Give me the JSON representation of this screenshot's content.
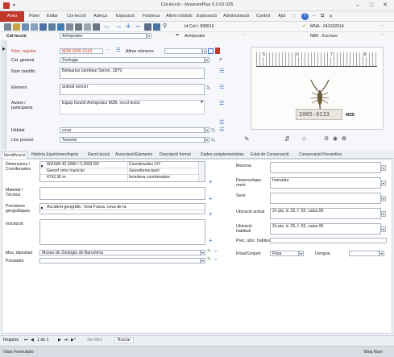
{
  "window": {
    "title": "Col·lecció - MuseumPlus 5.0.02 025",
    "minimize": "–",
    "maximize": "□",
    "close": "✕"
  },
  "menu": [
    "Arxiu",
    "Fitxer",
    "Editar",
    "Col·lecció",
    "Adreça",
    "Exposició",
    "Fototeca",
    "Altres mòduls",
    "Exploració",
    "Administració",
    "Control",
    "Ajut"
  ],
  "toolbar": {
    "help_icon": "?"
  },
  "record": {
    "module_label": "Col·lecció",
    "module_value": "Artròpodes",
    "id_label": "Id Col·l: 899516",
    "id_value": "Artròpodes",
    "user": "MNA - 24/10/2014",
    "user2": "NBfr - Escriure"
  },
  "fields": {
    "num_registre_label": "Núm. registre",
    "num_registre": "MZB 2005-0133",
    "altres_numeros_label": "Altres números",
    "cat_general_label": "Cat. general",
    "cat_general": "Zoologia",
    "nom_cientific_label": "Nom científic",
    "nom_cientific": "Belisarius xambeui Simon, 1879",
    "element_label": "Element",
    "element": "animal sencer",
    "autors_label": "Autors / participants",
    "autors": "Equip Gestió Artròpodes MZB, recol·lector",
    "habitat_label": "Hàbitat",
    "habitat": "cova",
    "lloc_label": "Lloc proced.",
    "lloc": "Tavertet"
  },
  "tabs": [
    "Identificació",
    "Història Espècimen/Ingrés",
    "Recol·lecció",
    "Associació/Elements",
    "Descripció formal",
    "Dades complementàries",
    "Estat de Conservació",
    "Conservació Preventiva"
  ],
  "ident": {
    "dimensions_label": "Dimensions / Coordenades",
    "rows": [
      {
        "value": "WGS84 42,0066 / 2,3993 DD",
        "type": "Coordenades X/Y"
      },
      {
        "value": "Georef retro municipi",
        "type": "Georeferenciació"
      },
      {
        "value": "4742,36 m",
        "type": "Incertesa coordenades"
      }
    ],
    "material_label": "Material / Tècnica",
    "precisions_label": "Precisions geogràfiques",
    "precisions": "Accident geogràfic: Vora Fosca, cova de la",
    "inscripcio_label": "Inscripció",
    "mus_dipositari_label": "Mus. dipositari",
    "mus_dipositari": "Museu de Zoologia de Barcelona",
    "prestador_label": "Prestador"
  },
  "right": {
    "biozona_label": "Biozona",
    "desenvolupament_label": "Desenvolupa-ment",
    "desenvolupament": "Immadur",
    "sexe_label": "Sexe",
    "ubicacio_actual_label": "Ubicació actual",
    "ubicacio_actual": "2n pis, d. 25, f. 02, caixa 05",
    "ubicacio_habitual_label": "Ubicació habitual",
    "ubicacio_habitual": "2n pis, d. 25, f. 02, caixa 05",
    "prec_ubic_label": "Prec. ubic. habitual",
    "fitxa_label": "Fitxa/Conjunt",
    "fitxa": "Fitxa",
    "llengua_label": "Llengua"
  },
  "photo": {
    "label": "2005-0133",
    "sublabel": "MZB",
    "ruler_ticks": [
      "5",
      "6",
      "7",
      "8"
    ]
  },
  "bottom": {
    "registre": "Registre",
    "of": "1 de 1",
    "search_label": "Sin filtro",
    "search_button": "Buscar"
  },
  "status": {
    "left": "Vista Formulario",
    "right": "Bloq Num"
  },
  "colors": {
    "accent": "#c1392b",
    "link": "#3a6fd0",
    "number_red": "#c0392b"
  }
}
